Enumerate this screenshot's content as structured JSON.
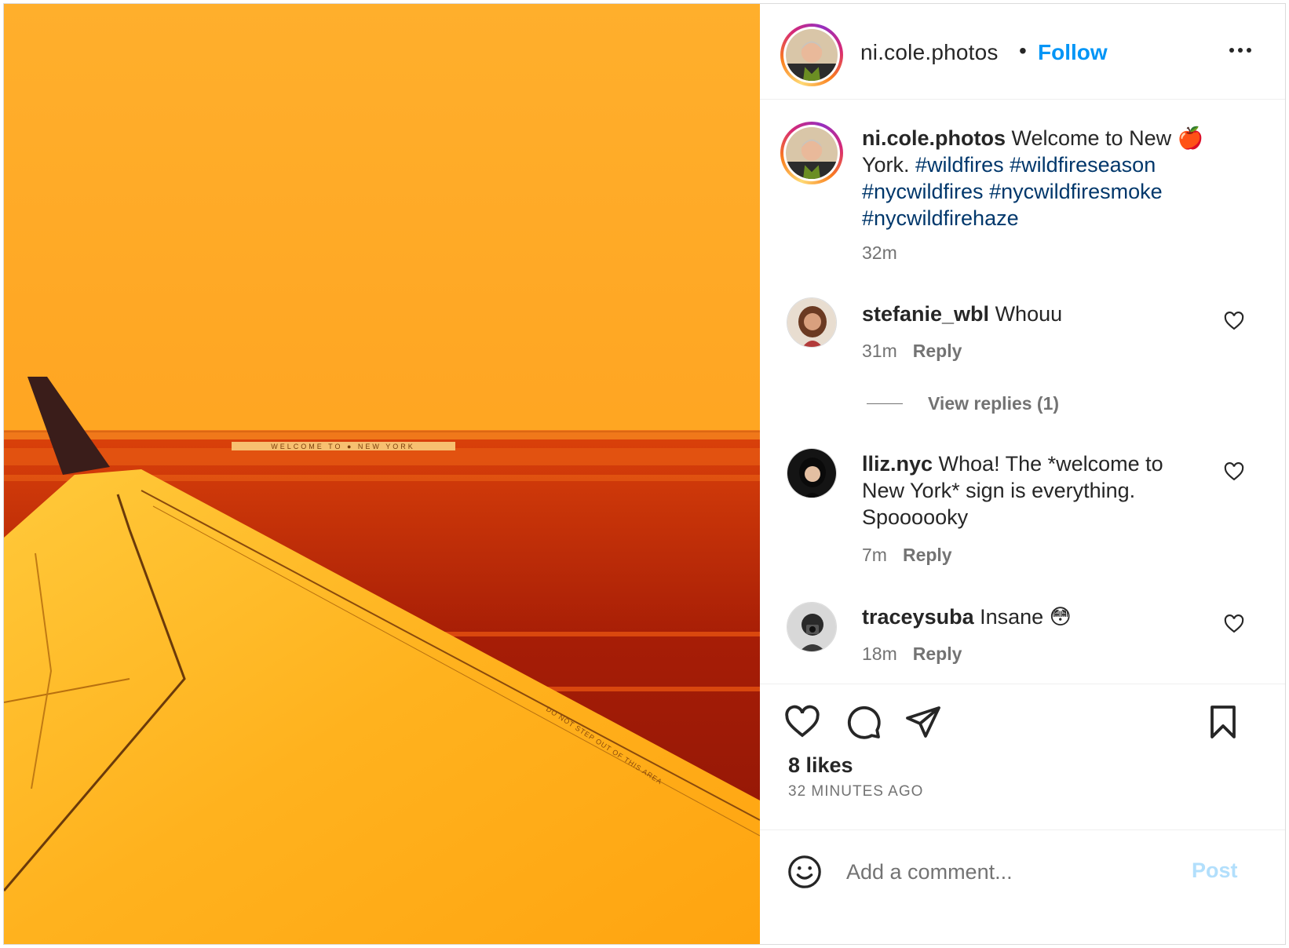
{
  "post": {
    "author": "ni.cole.photos",
    "separator": "•",
    "follow_label": "Follow",
    "more_icon": "more-horizontal-icon",
    "photo_sign_text": "WELCOME TO ● NEW YORK",
    "photo_wing_text": "DO NOT STEP OUT OF THIS AREA"
  },
  "caption": {
    "username": "ni.cole.photos",
    "text_before": " Welcome to New ",
    "emoji": "🍎",
    "text_after": " York. ",
    "tags": [
      "#wildfires",
      "#wildfireseason",
      "#nycwildfires",
      "#nycwildfiresmoke",
      "#nycwildfirehaze"
    ],
    "time": "32m"
  },
  "comments": [
    {
      "username": "stefanie_wbl",
      "text": " Whouu",
      "time": "31m",
      "reply_label": "Reply",
      "view_replies": "View replies (1)"
    },
    {
      "username": "lliz.nyc",
      "text": " Whoa! The *welcome to New York* sign is everything. Spoooooky",
      "time": "7m",
      "reply_label": "Reply"
    },
    {
      "username": "traceysuba",
      "text": " Insane ",
      "emoji": "😳",
      "time": "18m",
      "reply_label": "Reply"
    }
  ],
  "actions": {
    "likes": "8 likes",
    "ago": "32 MINUTES AGO",
    "icons": [
      "heart-icon",
      "comment-icon",
      "share-icon",
      "bookmark-icon"
    ]
  },
  "comment_box": {
    "placeholder": "Add a comment...",
    "post_label": "Post"
  },
  "colors": {
    "link": "#0095f6",
    "hashtag": "#00376b",
    "muted": "#737373",
    "post_disabled": "#b2dffc"
  }
}
